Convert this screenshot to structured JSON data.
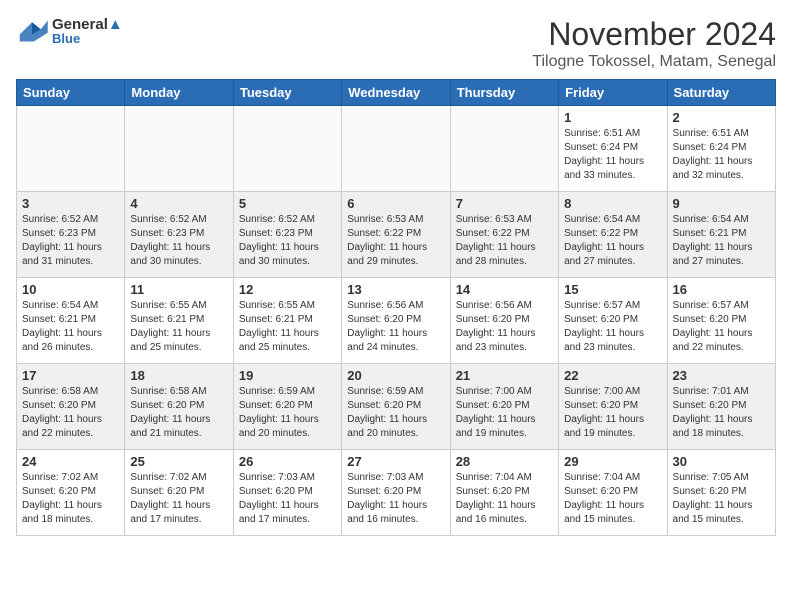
{
  "header": {
    "logo_line1": "General",
    "logo_line2": "Blue",
    "month": "November 2024",
    "location": "Tilogne Tokossel, Matam, Senegal"
  },
  "weekdays": [
    "Sunday",
    "Monday",
    "Tuesday",
    "Wednesday",
    "Thursday",
    "Friday",
    "Saturday"
  ],
  "weeks": [
    [
      {
        "day": "",
        "info": ""
      },
      {
        "day": "",
        "info": ""
      },
      {
        "day": "",
        "info": ""
      },
      {
        "day": "",
        "info": ""
      },
      {
        "day": "",
        "info": ""
      },
      {
        "day": "1",
        "info": "Sunrise: 6:51 AM\nSunset: 6:24 PM\nDaylight: 11 hours\nand 33 minutes."
      },
      {
        "day": "2",
        "info": "Sunrise: 6:51 AM\nSunset: 6:24 PM\nDaylight: 11 hours\nand 32 minutes."
      }
    ],
    [
      {
        "day": "3",
        "info": "Sunrise: 6:52 AM\nSunset: 6:23 PM\nDaylight: 11 hours\nand 31 minutes."
      },
      {
        "day": "4",
        "info": "Sunrise: 6:52 AM\nSunset: 6:23 PM\nDaylight: 11 hours\nand 30 minutes."
      },
      {
        "day": "5",
        "info": "Sunrise: 6:52 AM\nSunset: 6:23 PM\nDaylight: 11 hours\nand 30 minutes."
      },
      {
        "day": "6",
        "info": "Sunrise: 6:53 AM\nSunset: 6:22 PM\nDaylight: 11 hours\nand 29 minutes."
      },
      {
        "day": "7",
        "info": "Sunrise: 6:53 AM\nSunset: 6:22 PM\nDaylight: 11 hours\nand 28 minutes."
      },
      {
        "day": "8",
        "info": "Sunrise: 6:54 AM\nSunset: 6:22 PM\nDaylight: 11 hours\nand 27 minutes."
      },
      {
        "day": "9",
        "info": "Sunrise: 6:54 AM\nSunset: 6:21 PM\nDaylight: 11 hours\nand 27 minutes."
      }
    ],
    [
      {
        "day": "10",
        "info": "Sunrise: 6:54 AM\nSunset: 6:21 PM\nDaylight: 11 hours\nand 26 minutes."
      },
      {
        "day": "11",
        "info": "Sunrise: 6:55 AM\nSunset: 6:21 PM\nDaylight: 11 hours\nand 25 minutes."
      },
      {
        "day": "12",
        "info": "Sunrise: 6:55 AM\nSunset: 6:21 PM\nDaylight: 11 hours\nand 25 minutes."
      },
      {
        "day": "13",
        "info": "Sunrise: 6:56 AM\nSunset: 6:20 PM\nDaylight: 11 hours\nand 24 minutes."
      },
      {
        "day": "14",
        "info": "Sunrise: 6:56 AM\nSunset: 6:20 PM\nDaylight: 11 hours\nand 23 minutes."
      },
      {
        "day": "15",
        "info": "Sunrise: 6:57 AM\nSunset: 6:20 PM\nDaylight: 11 hours\nand 23 minutes."
      },
      {
        "day": "16",
        "info": "Sunrise: 6:57 AM\nSunset: 6:20 PM\nDaylight: 11 hours\nand 22 minutes."
      }
    ],
    [
      {
        "day": "17",
        "info": "Sunrise: 6:58 AM\nSunset: 6:20 PM\nDaylight: 11 hours\nand 22 minutes."
      },
      {
        "day": "18",
        "info": "Sunrise: 6:58 AM\nSunset: 6:20 PM\nDaylight: 11 hours\nand 21 minutes."
      },
      {
        "day": "19",
        "info": "Sunrise: 6:59 AM\nSunset: 6:20 PM\nDaylight: 11 hours\nand 20 minutes."
      },
      {
        "day": "20",
        "info": "Sunrise: 6:59 AM\nSunset: 6:20 PM\nDaylight: 11 hours\nand 20 minutes."
      },
      {
        "day": "21",
        "info": "Sunrise: 7:00 AM\nSunset: 6:20 PM\nDaylight: 11 hours\nand 19 minutes."
      },
      {
        "day": "22",
        "info": "Sunrise: 7:00 AM\nSunset: 6:20 PM\nDaylight: 11 hours\nand 19 minutes."
      },
      {
        "day": "23",
        "info": "Sunrise: 7:01 AM\nSunset: 6:20 PM\nDaylight: 11 hours\nand 18 minutes."
      }
    ],
    [
      {
        "day": "24",
        "info": "Sunrise: 7:02 AM\nSunset: 6:20 PM\nDaylight: 11 hours\nand 18 minutes."
      },
      {
        "day": "25",
        "info": "Sunrise: 7:02 AM\nSunset: 6:20 PM\nDaylight: 11 hours\nand 17 minutes."
      },
      {
        "day": "26",
        "info": "Sunrise: 7:03 AM\nSunset: 6:20 PM\nDaylight: 11 hours\nand 17 minutes."
      },
      {
        "day": "27",
        "info": "Sunrise: 7:03 AM\nSunset: 6:20 PM\nDaylight: 11 hours\nand 16 minutes."
      },
      {
        "day": "28",
        "info": "Sunrise: 7:04 AM\nSunset: 6:20 PM\nDaylight: 11 hours\nand 16 minutes."
      },
      {
        "day": "29",
        "info": "Sunrise: 7:04 AM\nSunset: 6:20 PM\nDaylight: 11 hours\nand 15 minutes."
      },
      {
        "day": "30",
        "info": "Sunrise: 7:05 AM\nSunset: 6:20 PM\nDaylight: 11 hours\nand 15 minutes."
      }
    ]
  ]
}
